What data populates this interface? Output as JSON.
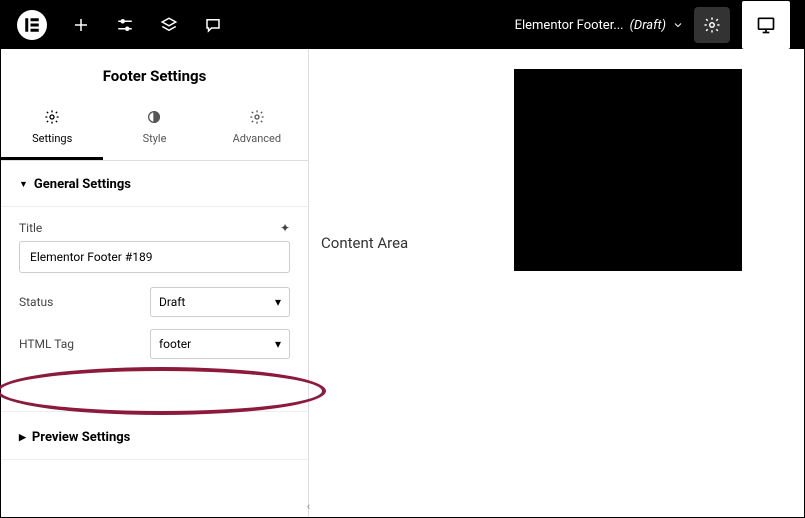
{
  "topbar": {
    "doc_title": "Elementor Footer...",
    "doc_status": "(Draft)"
  },
  "sidebar": {
    "title": "Footer Settings",
    "tabs": {
      "settings": "Settings",
      "style": "Style",
      "advanced": "Advanced"
    },
    "general_settings": {
      "heading": "General Settings",
      "title_label": "Title",
      "title_value": "Elementor Footer #189",
      "status_label": "Status",
      "status_value": "Draft",
      "html_tag_label": "HTML Tag",
      "html_tag_value": "footer"
    },
    "preview_settings": {
      "heading": "Preview Settings"
    }
  },
  "canvas": {
    "content_label": "Content Area"
  }
}
